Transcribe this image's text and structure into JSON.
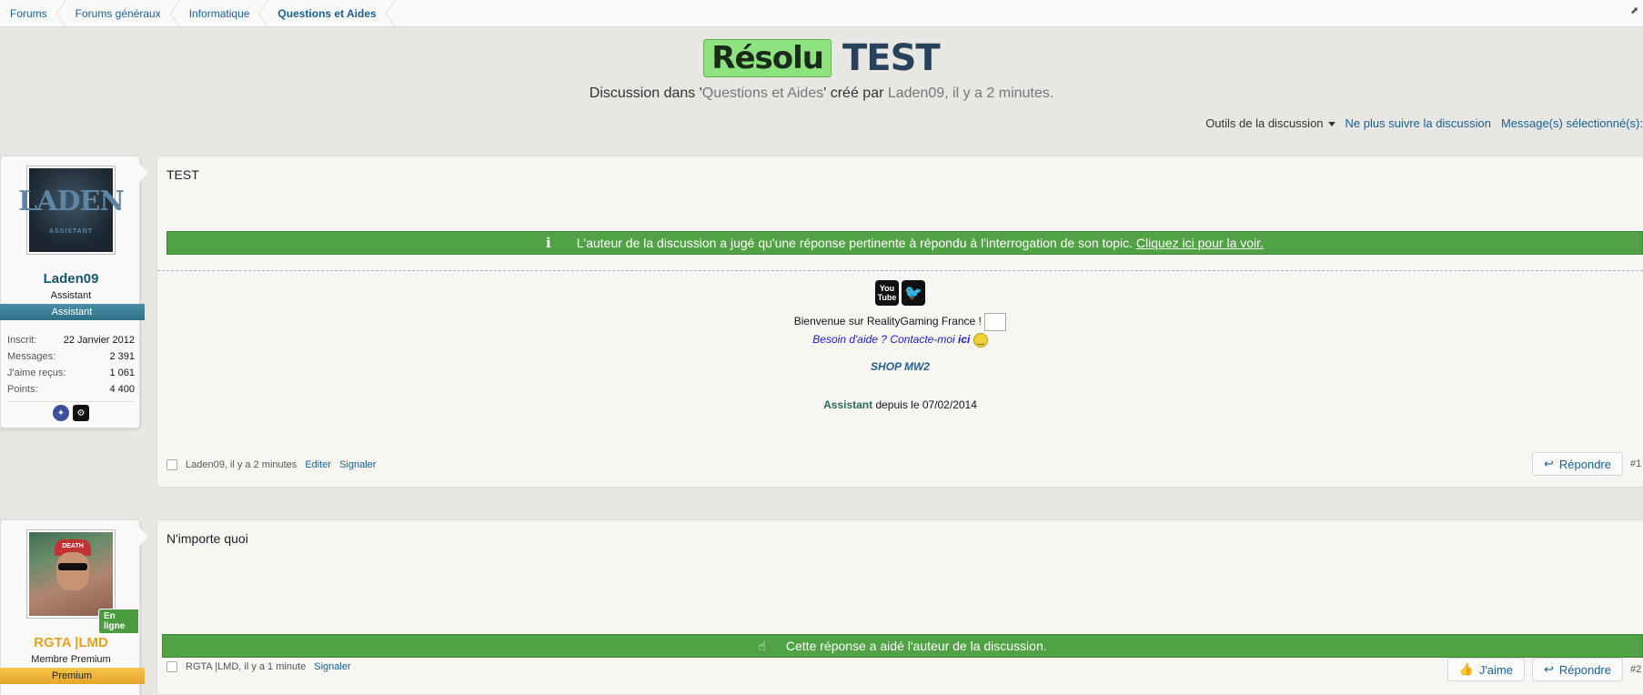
{
  "breadcrumb": [
    "Forums",
    "Forums généraux",
    "Informatique",
    "Questions et Aides"
  ],
  "expand_icon": "external-link-icon",
  "title": {
    "prefix": "Résolu",
    "text": "TEST"
  },
  "subline": {
    "p1": "Discussion dans '",
    "forum": "Questions et Aides",
    "p2": "' créé par ",
    "author": "Laden09",
    "p3": ", il y a 2 minutes."
  },
  "tools": {
    "thread_tools": "Outils de la discussion",
    "unwatch": "Ne plus suivre la discussion",
    "selected": "Message(s) sélectionné(s):"
  },
  "posts": [
    {
      "username": "Laden09",
      "user_title": "Assistant",
      "ribbon": "Assistant",
      "avatar_text": "LADEN",
      "avatar_sub": "ASSISTANT",
      "stats": [
        {
          "label": "Inscrit:",
          "value": "22 Janvier 2012"
        },
        {
          "label": "Messages:",
          "value": "2 391"
        },
        {
          "label": "J'aime reçus:",
          "value": "1 061"
        },
        {
          "label": "Points:",
          "value": "4 400"
        }
      ],
      "body": "TEST",
      "best_answer_notice": "L'auteur de la discussion a jugé qu'une réponse pertinente à répondu à l'interrogation de son topic.",
      "best_answer_link": "Cliquez ici pour la voir.",
      "signature": {
        "youtube_label": "You Tube",
        "welcome": "Bienvenue sur RealityGaming France !",
        "help": "Besoin d'aide ? Contacte-moi ",
        "help_link": "ici",
        "shop": "SHOP MW2",
        "role": "Assistant",
        "since": " depuis le 07/02/2014"
      },
      "meta_author": "Laden09, il y a 2 minutes",
      "edit": "Editer",
      "report": "Signaler",
      "reply": "Répondre",
      "number": "#1"
    },
    {
      "username": "RGTA |LMD",
      "user_title": "Membre Premium",
      "ribbon": "Premium",
      "online": "En ligne",
      "avatar_cap": "DEATH",
      "body": "N'importe quoi",
      "helped_notice": "Cette réponse a aidé l'auteur de la discussion.",
      "meta_author": "RGTA |LMD, il y a 1 minute",
      "report": "Signaler",
      "like": "J'aime",
      "reply": "Répondre",
      "number": "#2"
    }
  ],
  "colors": {
    "accent_green": "#50a244",
    "link_blue": "#176093",
    "assistant_name": "#14566e",
    "premium_name": "#e8a020"
  }
}
